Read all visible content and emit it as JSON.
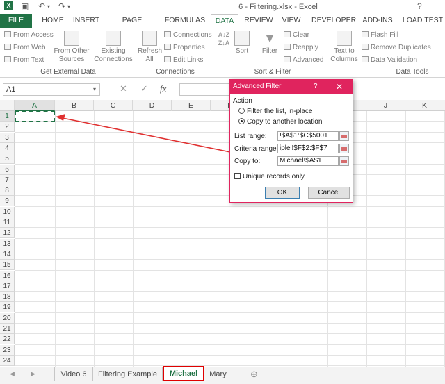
{
  "titlebar": {
    "title": "6 - Filtering.xlsx - Excel"
  },
  "ribbon_tabs": [
    "FILE",
    "HOME",
    "INSERT",
    "PAGE LAYOUT",
    "FORMULAS",
    "DATA",
    "REVIEW",
    "VIEW",
    "DEVELOPER",
    "ADD-INS",
    "LOAD TEST"
  ],
  "active_tab": "DATA",
  "ribbon": {
    "get_external": {
      "from_access": "From Access",
      "from_web": "From Web",
      "from_text": "From Text",
      "from_other_1": "From Other",
      "from_other_2": "Sources",
      "existing_1": "Existing",
      "existing_2": "Connections",
      "label": "Get External Data"
    },
    "connections": {
      "refresh_1": "Refresh",
      "refresh_2": "All",
      "connections": "Connections",
      "properties": "Properties",
      "edit_links": "Edit Links",
      "label": "Connections"
    },
    "sort_filter": {
      "sort": "Sort",
      "filter": "Filter",
      "clear": "Clear",
      "reapply": "Reapply",
      "advanced": "Advanced",
      "label": "Sort & Filter"
    },
    "data_tools": {
      "text_1": "Text to",
      "text_2": "Columns",
      "flash_fill": "Flash Fill",
      "remove_dup": "Remove Duplicates",
      "validation": "Data Validation",
      "label": "Data Tools"
    }
  },
  "formula_bar": {
    "name_box": "A1",
    "fx": "fx"
  },
  "columns": [
    "A",
    "B",
    "C",
    "D",
    "E",
    "F",
    "G",
    "H",
    "I",
    "J",
    "K"
  ],
  "rows": [
    "1",
    "2",
    "3",
    "4",
    "5",
    "6",
    "7",
    "8",
    "9",
    "10",
    "11",
    "12",
    "13",
    "14",
    "15",
    "16",
    "17",
    "18",
    "19",
    "20",
    "21",
    "22",
    "23",
    "24"
  ],
  "dialog": {
    "title": "Advanced Filter",
    "help": "?",
    "close": "✕",
    "action_label": "Action",
    "radio_filter": "Filter the list, in-place",
    "radio_copy": "Copy to another location",
    "list_range_label": "List range:",
    "list_range_value": "!$A$1:$C$5001",
    "criteria_label": "Criteria range:",
    "criteria_value": "iple'!$F$2:$F$7",
    "copy_to_label": "Copy to:",
    "copy_to_value": "Michael!$A$1",
    "unique_label": "Unique records only",
    "ok": "OK",
    "cancel": "Cancel"
  },
  "sheet_tabs": [
    "Video 6",
    "Filtering Example",
    "Michael",
    "Mary"
  ],
  "active_sheet": "Michael",
  "colors": {
    "excel_green": "#217346",
    "dialog_accent": "#e0245e",
    "annotation_red": "#e00000"
  }
}
